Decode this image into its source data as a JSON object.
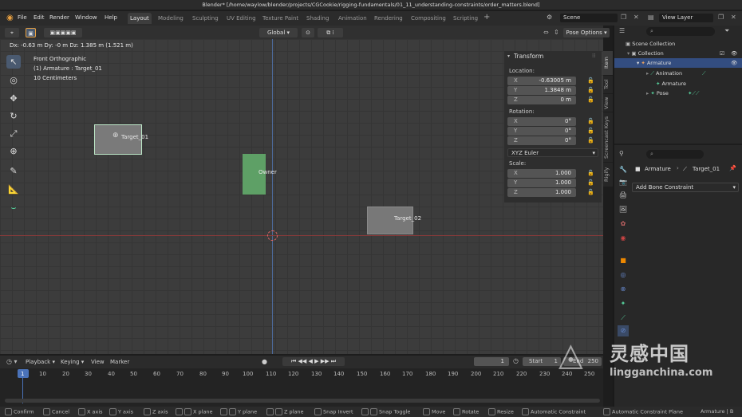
{
  "window": {
    "title": "Blender* [/home/waylow/blender/projects/CGCookie/rigging-fundamentals/01_11_understanding-constraints/order_matters.blend]"
  },
  "menu": {
    "items": [
      "File",
      "Edit",
      "Render",
      "Window",
      "Help"
    ]
  },
  "workspaces": [
    "Layout",
    "Modeling",
    "Sculpting",
    "UV Editing",
    "Texture Paint",
    "Shading",
    "Animation",
    "Rendering",
    "Compositing",
    "Scripting"
  ],
  "scene": {
    "name": "Scene",
    "view_layer": "View Layer"
  },
  "header": {
    "orientation": "Global",
    "pose_options": "Pose Options"
  },
  "viewport": {
    "delta": "Dx: -0.63 m   Dy: -0 m   Dz: 1.385 m (1.521 m)",
    "view_name": "Front Orthographic",
    "active": "(1) Armature : Target_01",
    "scale": "10 Centimeters",
    "bones": [
      {
        "label": "Target_01"
      },
      {
        "label": "Owner"
      },
      {
        "label": "Target_02"
      }
    ]
  },
  "transform": {
    "title": "Transform",
    "location_label": "Location:",
    "location": [
      {
        "axis": "X",
        "value": "-0.63005 m"
      },
      {
        "axis": "Y",
        "value": "1.3848 m"
      },
      {
        "axis": "Z",
        "value": "0 m"
      }
    ],
    "rotation_label": "Rotation:",
    "rotation": [
      {
        "axis": "X",
        "value": "0°"
      },
      {
        "axis": "Y",
        "value": "0°"
      },
      {
        "axis": "Z",
        "value": "0°"
      }
    ],
    "rotation_mode": "XYZ Euler",
    "scale_label": "Scale:",
    "scale": [
      {
        "axis": "X",
        "value": "1.000"
      },
      {
        "axis": "Y",
        "value": "1.000"
      },
      {
        "axis": "Z",
        "value": "1.000"
      }
    ]
  },
  "side_tabs": [
    "Item",
    "Tool",
    "View",
    "Screencast Keys",
    "Rigify"
  ],
  "outliner": {
    "rows": [
      "Scene Collection",
      "Collection",
      "Armature",
      "Animation",
      "Armature",
      "Pose"
    ]
  },
  "properties": {
    "object": "Armature",
    "bone": "Target_01",
    "add_constraint": "Add Bone Constraint"
  },
  "timeline": {
    "menus": [
      "Playback",
      "Keying",
      "View",
      "Marker"
    ],
    "current_frame": "1",
    "start_label": "Start",
    "start": "1",
    "end_label": "End",
    "end": "250",
    "ticks": [
      "1",
      "10",
      "20",
      "30",
      "40",
      "50",
      "60",
      "70",
      "80",
      "90",
      "100",
      "110",
      "120",
      "130",
      "140",
      "150",
      "160",
      "170",
      "180",
      "190",
      "200",
      "210",
      "220",
      "230",
      "240",
      "250"
    ]
  },
  "status": {
    "items": [
      "Confirm",
      "Cancel",
      "X axis",
      "Y axis",
      "Z axis",
      "X plane",
      "Y plane",
      "Z plane",
      "Snap Invert",
      "Snap Toggle",
      "Move",
      "Rotate",
      "Resize",
      "Automatic Constraint",
      "Automatic Constraint Plane"
    ],
    "right": "Armature | B"
  },
  "watermark": {
    "main": "灵感中国",
    "sub": "lingganchina.com"
  }
}
